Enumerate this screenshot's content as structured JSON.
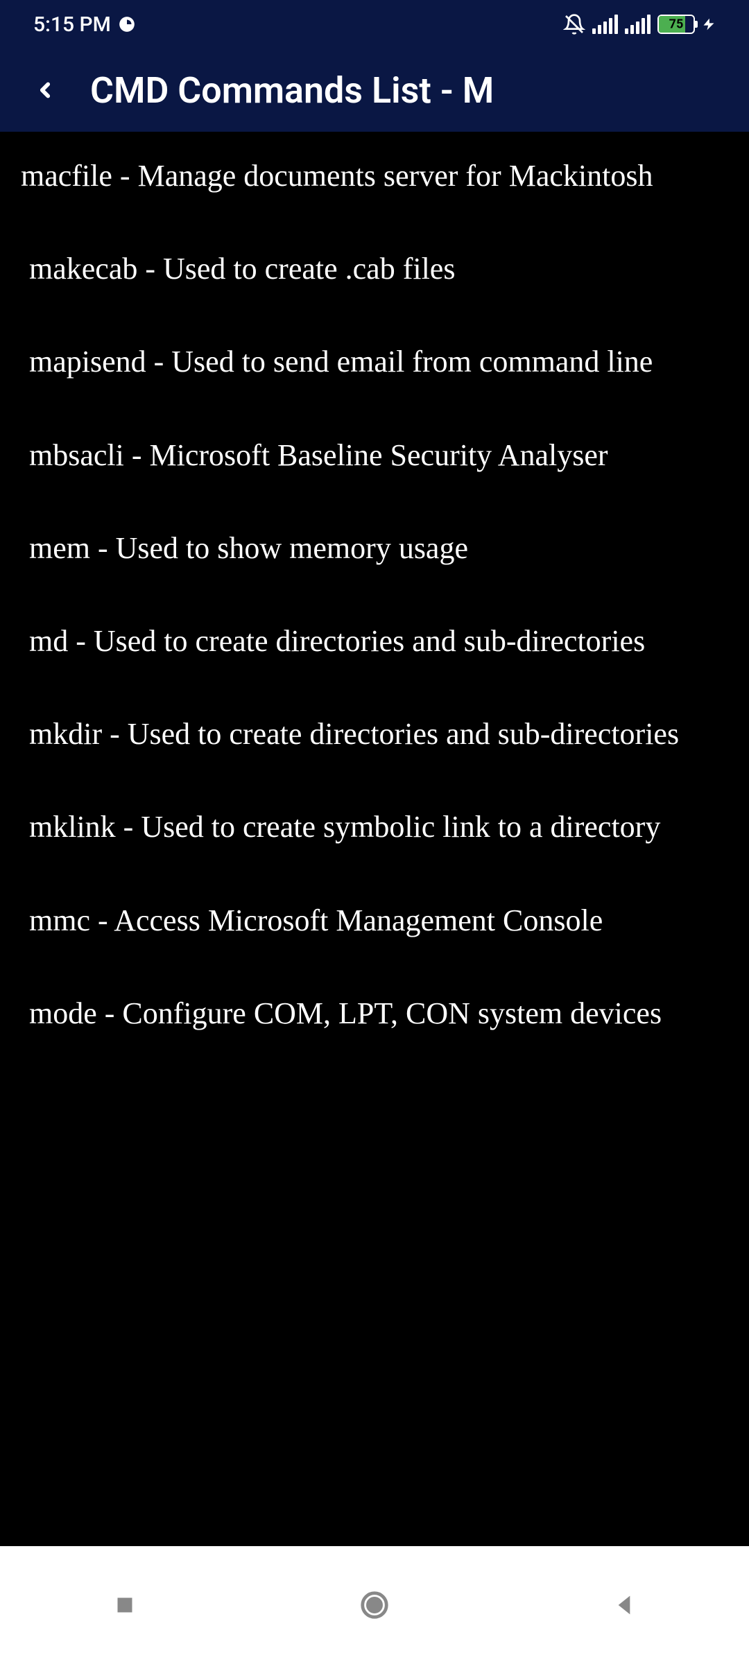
{
  "status_bar": {
    "time": "5:15 PM",
    "battery_pct": "75",
    "battery_fill_width": "75%"
  },
  "header": {
    "title": "CMD Commands List - M"
  },
  "commands": [
    "macfile - Manage documents server for Mackintosh",
    " makecab - Used to create .cab files",
    " mapisend - Used to send email from command line",
    " mbsacli - Microsoft Baseline Security Analyser",
    " mem - Used to show memory usage",
    " md - Used to create directories and sub-directories",
    " mkdir - Used to create directories and sub-directories",
    " mklink - Used to create symbolic link to a directory",
    " mmc - Access Microsoft Management Console",
    " mode - Configure COM, LPT, CON system devices"
  ]
}
